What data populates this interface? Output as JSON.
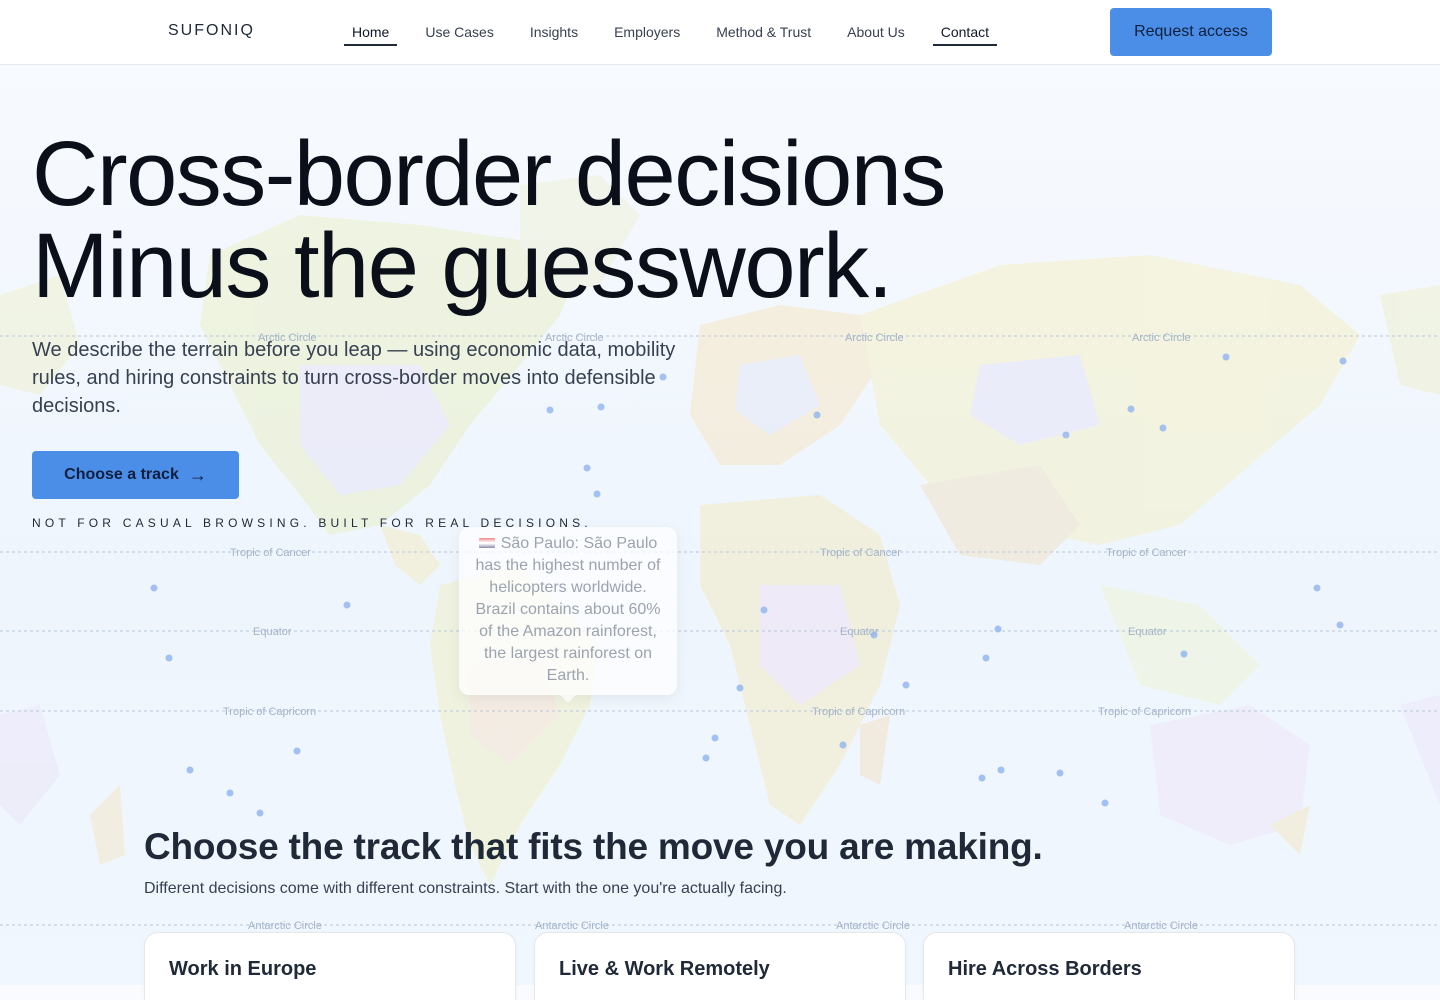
{
  "header": {
    "logo": "SUFONIQ",
    "nav": [
      {
        "label": "Home",
        "state": "active"
      },
      {
        "label": "Use Cases"
      },
      {
        "label": "Insights"
      },
      {
        "label": "Employers"
      },
      {
        "label": "Method & Trust"
      },
      {
        "label": "About Us"
      },
      {
        "label": "Contact",
        "state": "current"
      }
    ],
    "cta_label": "Request access"
  },
  "hero": {
    "title_line1": "Cross-border decisions",
    "title_line2": "Minus the guesswork.",
    "subtitle": "We describe the terrain before you leap — using economic data, mobility rules, and hiring constraints to turn cross-border moves into defensible decisions.",
    "button_label": "Choose a track",
    "button_icon": "arrow-right-icon",
    "tagline": "NOT FOR CASUAL BROWSING. BUILT FOR REAL DECISIONS."
  },
  "map": {
    "latitude_labels": {
      "arctic": "Arctic Circle",
      "cancer": "Tropic of Cancer",
      "equator": "Equator",
      "capricorn": "Tropic of Capricorn",
      "antarctic": "Antarctic Circle"
    }
  },
  "tooltip": {
    "icon": "brazil-flag-icon",
    "text": "São Paulo: São Paulo has the highest number of helicopters worldwide. Brazil contains about 60% of the Amazon rainforest, the largest rainforest on Earth."
  },
  "tracks": {
    "title": "Choose the track that fits the move you are making.",
    "subtitle": "Different decisions come with different constraints. Start with the one you're actually facing.",
    "cards": [
      {
        "title": "Work in Europe"
      },
      {
        "title": "Live & Work Remotely"
      },
      {
        "title": "Hire Across Borders"
      }
    ]
  },
  "colors": {
    "accent": "#4a8ee8",
    "text": "#111827",
    "background": "#f2f7fd"
  }
}
